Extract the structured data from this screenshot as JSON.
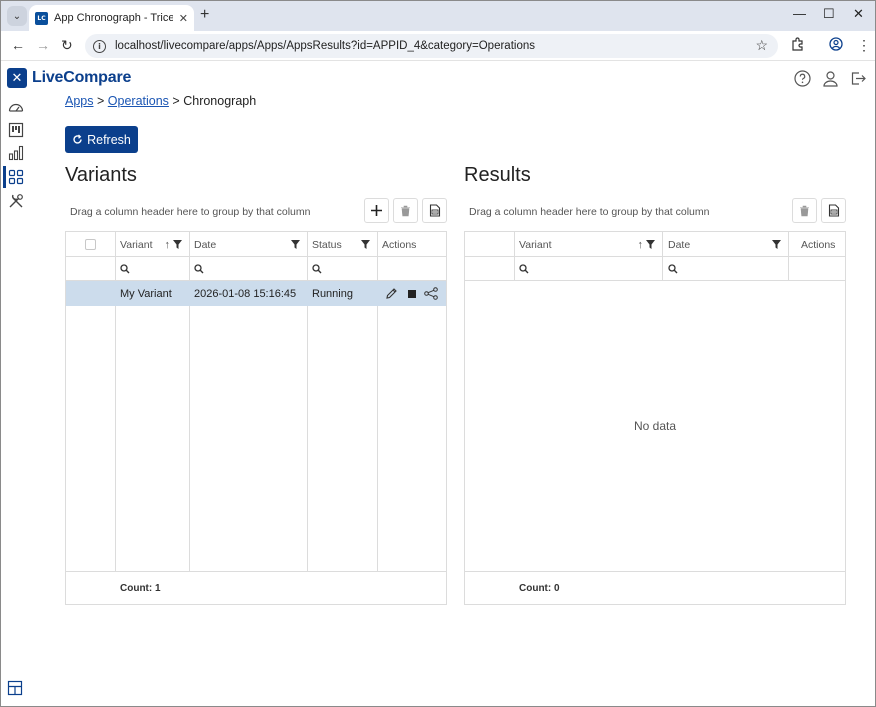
{
  "browser": {
    "tab_title": "App Chronograph - Tricentis Li",
    "favicon_text": "LC",
    "url": "localhost/livecompare/apps/Apps/AppsResults?id=APPID_4&category=Operations"
  },
  "app": {
    "logo_text": "LiveCompare",
    "logo_mark": "✕",
    "header_icons": [
      "help-icon",
      "user-icon",
      "logout-icon"
    ]
  },
  "sidebar": {
    "items": [
      "dashboard-icon",
      "kanban-icon",
      "bar-chart-icon",
      "apps-grid-icon",
      "tools-icon"
    ],
    "active_index": 3,
    "bottom_item": "layout-icon"
  },
  "breadcrumb": {
    "items": [
      {
        "label": "Apps",
        "link": true
      },
      {
        "label": "Operations",
        "link": true
      },
      {
        "label": "Chronograph",
        "link": false
      }
    ],
    "separator": ">"
  },
  "refresh_button": {
    "label": "Refresh",
    "icon": "refresh-icon"
  },
  "variants": {
    "title": "Variants",
    "group_hint": "Drag a column header here to group by that column",
    "columns": [
      "Variant",
      "Date",
      "Status",
      "Actions"
    ],
    "rows": [
      {
        "variant": "My Variant",
        "date": "2026-01-08 15:16:45",
        "status": "Running"
      }
    ],
    "count_label": "Count: 1"
  },
  "results": {
    "title": "Results",
    "group_hint": "Drag a column header here to group by that column",
    "columns": [
      "Variant",
      "Date",
      "Actions"
    ],
    "empty_text": "No data",
    "count_label": "Count: 0"
  },
  "colors": {
    "primary": "#0b3f8c",
    "selected_row": "#ccdcec",
    "link": "#1a55b3"
  }
}
